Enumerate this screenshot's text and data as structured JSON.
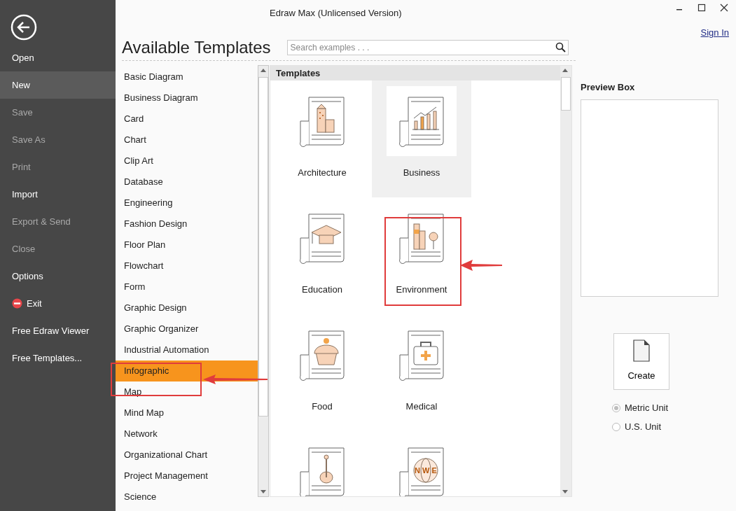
{
  "window": {
    "title": "Edraw Max (Unlicensed Version)",
    "sign_in": "Sign In"
  },
  "sidebar": {
    "items": [
      {
        "label": "Open",
        "selected": false,
        "disabled": false,
        "kind": "plain"
      },
      {
        "label": "New",
        "selected": true,
        "disabled": false,
        "kind": "plain"
      },
      {
        "label": "Save",
        "selected": false,
        "disabled": true,
        "kind": "plain"
      },
      {
        "label": "Save As",
        "selected": false,
        "disabled": true,
        "kind": "plain"
      },
      {
        "label": "Print",
        "selected": false,
        "disabled": true,
        "kind": "plain"
      },
      {
        "label": "Import",
        "selected": false,
        "disabled": false,
        "kind": "plain"
      },
      {
        "label": "Export & Send",
        "selected": false,
        "disabled": true,
        "kind": "plain"
      },
      {
        "label": "Close",
        "selected": false,
        "disabled": true,
        "kind": "plain"
      },
      {
        "label": "Options",
        "selected": false,
        "disabled": false,
        "kind": "plain"
      },
      {
        "label": "Exit",
        "selected": false,
        "disabled": false,
        "kind": "exit"
      },
      {
        "label": "Free Edraw Viewer",
        "selected": false,
        "disabled": false,
        "kind": "plain"
      },
      {
        "label": "Free Templates...",
        "selected": false,
        "disabled": false,
        "kind": "plain"
      }
    ]
  },
  "heading": "Available Templates",
  "search": {
    "placeholder": "Search examples . . ."
  },
  "categories": [
    {
      "label": "Basic Diagram",
      "selected": false
    },
    {
      "label": "Business Diagram",
      "selected": false
    },
    {
      "label": "Card",
      "selected": false
    },
    {
      "label": "Chart",
      "selected": false
    },
    {
      "label": "Clip Art",
      "selected": false
    },
    {
      "label": "Database",
      "selected": false
    },
    {
      "label": "Engineering",
      "selected": false
    },
    {
      "label": "Fashion Design",
      "selected": false
    },
    {
      "label": "Floor Plan",
      "selected": false
    },
    {
      "label": "Flowchart",
      "selected": false
    },
    {
      "label": "Form",
      "selected": false
    },
    {
      "label": "Graphic Design",
      "selected": false
    },
    {
      "label": "Graphic Organizer",
      "selected": false
    },
    {
      "label": "Industrial Automation",
      "selected": false
    },
    {
      "label": "Infographic",
      "selected": true
    },
    {
      "label": "Map",
      "selected": false
    },
    {
      "label": "Mind Map",
      "selected": false
    },
    {
      "label": "Network",
      "selected": false
    },
    {
      "label": "Organizational Chart",
      "selected": false
    },
    {
      "label": "Project Management",
      "selected": false
    },
    {
      "label": "Science",
      "selected": false
    }
  ],
  "templates": {
    "header": "Templates",
    "items": [
      {
        "name": "Architecture",
        "kind": "architecture",
        "selected": false
      },
      {
        "name": "Business",
        "kind": "business",
        "selected": true
      },
      {
        "name": "Education",
        "kind": "education",
        "selected": false
      },
      {
        "name": "Environment",
        "kind": "environment",
        "selected": false
      },
      {
        "name": "Food",
        "kind": "food",
        "selected": false
      },
      {
        "name": "Medical",
        "kind": "medical",
        "selected": false
      },
      {
        "kind": "music",
        "selected": false
      },
      {
        "kind": "globe",
        "selected": false,
        "icon_text": "N W E"
      }
    ]
  },
  "preview": {
    "title": "Preview Box"
  },
  "create_button": "Create",
  "units": [
    {
      "label": "Metric Unit",
      "selected": true
    },
    {
      "label": "U.S. Unit",
      "selected": false
    }
  ]
}
